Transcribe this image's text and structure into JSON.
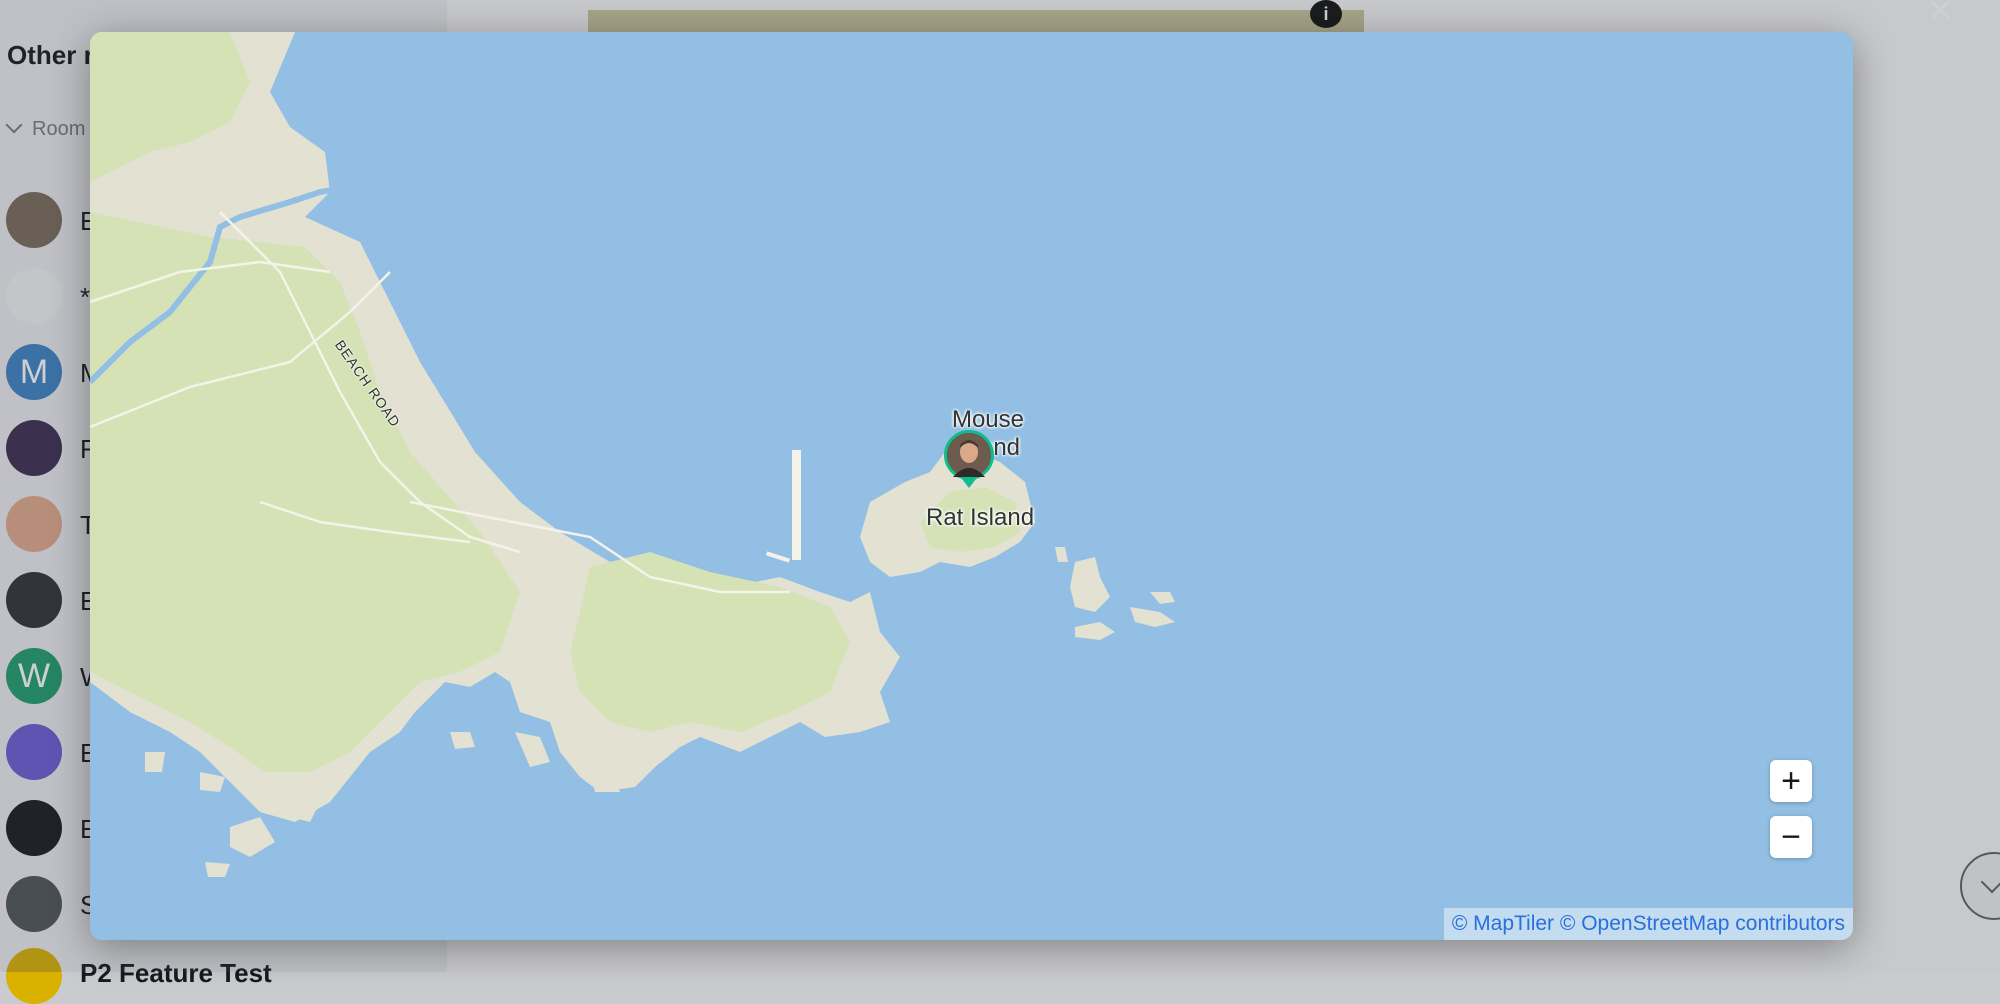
{
  "background": {
    "sidebar_title": "Other r",
    "rooms_section_label": "Room",
    "room_initials": [
      "E",
      "*",
      "M",
      "F",
      "T",
      "E",
      "W",
      "E",
      "E",
      "S"
    ],
    "room_letter_avatars": {
      "m": "M",
      "w": "W"
    },
    "close_icon": "×",
    "info_icon": "i",
    "bottom_room_label": "P2 Feature Test"
  },
  "map": {
    "labels": {
      "mouse_island": "Mouse Island",
      "rat_island": "Rat Island",
      "beach_road": "BEACH ROAD"
    },
    "controls": {
      "zoom_in": "+",
      "zoom_out": "−"
    },
    "attribution": "© MapTiler © OpenStreetMap contributors",
    "colors": {
      "water": "#92bfe3",
      "land": "#e2e1d2",
      "park": "#d4e2b6",
      "marker_border": "#0dbd8b"
    }
  }
}
